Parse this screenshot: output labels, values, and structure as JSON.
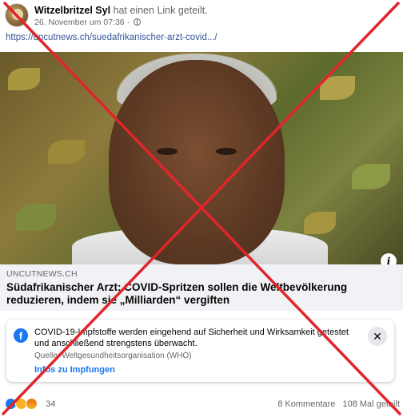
{
  "post": {
    "author": "Witzelbritzel Syl",
    "action": "hat einen Link geteilt.",
    "timestamp": "26. November um 07:36",
    "link_url": "https://uncutnews.ch/suedafrikanischer-arzt-covid.../"
  },
  "article": {
    "domain": "UNCUTNEWS.CH",
    "title": "Südafrikanischer Arzt: COVID-Spritzen sollen die Weltbevölkerung reduzieren, indem sie „Milliarden“ vergiften",
    "info_icon": "info-icon"
  },
  "info_box": {
    "text": "COVID-19-Impfstoffe werden eingehend auf Sicherheit und Wirksamkeit getestet und anschließend strengstens überwacht.",
    "source": "Quelle: Weltgesundheitsorganisation (WHO)",
    "link_label": "Infos zu Impfungen",
    "close_label": "✕"
  },
  "footer": {
    "reaction_count": "34",
    "comments": "8 Kommentare",
    "shares": "108 Mal geteilt"
  },
  "colors": {
    "link": "#385898",
    "facebook_blue": "#1877f2",
    "cross_red": "#e0262b"
  }
}
